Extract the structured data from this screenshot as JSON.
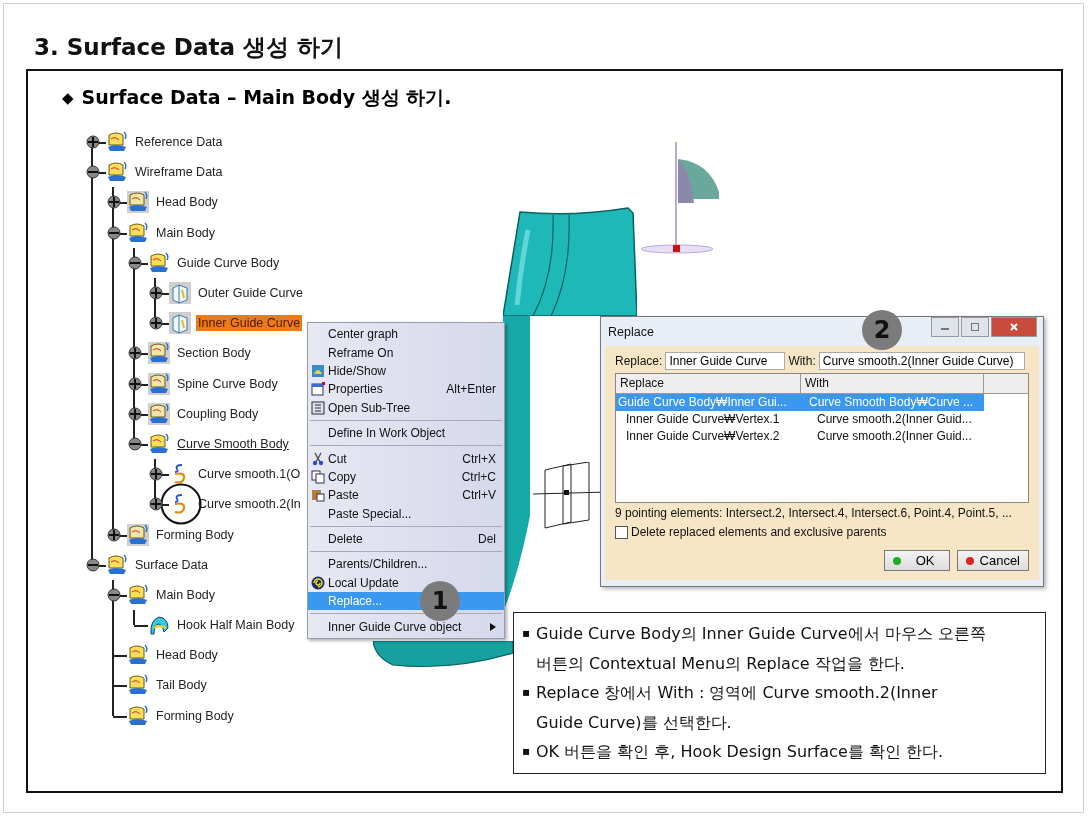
{
  "title": "3. Surface Data 생성 하기",
  "subtitle": {
    "bullet": "◆",
    "text": "Surface Data – Main Body 생성 하기."
  },
  "tree": {
    "items": [
      {
        "label": "Reference Data",
        "kind": "body",
        "expanded": false,
        "selected": false
      },
      {
        "label": "Wireframe Data",
        "kind": "body",
        "expanded": true,
        "selected": false,
        "children": [
          {
            "label": "Head Body",
            "kind": "greybody",
            "expanded": false,
            "selected": false
          },
          {
            "label": "Main Body",
            "kind": "body",
            "expanded": true,
            "selected": false,
            "children": [
              {
                "label": "Guide Curve Body",
                "kind": "body",
                "expanded": true,
                "selected": false,
                "children": [
                  {
                    "label": "Outer Guide Curve",
                    "kind": "sketch",
                    "expanded": false,
                    "selected": false
                  },
                  {
                    "label": "Inner Guide Curve",
                    "kind": "sketch",
                    "expanded": false,
                    "selected": true
                  }
                ]
              },
              {
                "label": "Section Body",
                "kind": "greybody",
                "expanded": false,
                "selected": false
              },
              {
                "label": "Spine Curve Body",
                "kind": "greybody",
                "expanded": false,
                "selected": false
              },
              {
                "label": "Coupling Body",
                "kind": "greybody",
                "expanded": false,
                "selected": false
              },
              {
                "label": "Curve Smooth Body",
                "kind": "body",
                "expanded": true,
                "selected": false,
                "underlined": true,
                "children": [
                  {
                    "label": "Curve smooth.1(O",
                    "kind": "curve",
                    "expanded": false,
                    "selected": false
                  },
                  {
                    "label": "Curve smooth.2(In",
                    "kind": "curve",
                    "expanded": false,
                    "selected": false,
                    "circled": true
                  }
                ]
              }
            ]
          },
          {
            "label": "Forming Body",
            "kind": "greybody",
            "expanded": false,
            "selected": false
          }
        ]
      },
      {
        "label": "Surface Data",
        "kind": "body",
        "expanded": true,
        "selected": false,
        "children": [
          {
            "label": "Main Body",
            "kind": "body",
            "expanded": true,
            "selected": false,
            "children": [
              {
                "label": "Hook Half Main Body",
                "kind": "surface",
                "selected": false
              }
            ]
          },
          {
            "label": "Head Body",
            "kind": "body",
            "selected": false
          },
          {
            "label": "Tail Body",
            "kind": "body",
            "selected": false
          },
          {
            "label": "Forming Body",
            "kind": "body",
            "selected": false
          }
        ]
      }
    ]
  },
  "menu": {
    "items": [
      {
        "kind": "item",
        "label": "Center graph",
        "selected": false
      },
      {
        "kind": "item",
        "label": "Reframe On",
        "selected": false
      },
      {
        "kind": "item",
        "label": "Hide/Show",
        "selected": false
      },
      {
        "kind": "item",
        "label": "Properties",
        "shortcut": "Alt+Enter",
        "selected": false
      },
      {
        "kind": "item",
        "label": "Open Sub-Tree",
        "selected": false
      },
      {
        "kind": "separator"
      },
      {
        "kind": "item",
        "label": "Define In Work Object",
        "selected": false
      },
      {
        "kind": "separator"
      },
      {
        "kind": "item",
        "label": "Cut",
        "shortcut": "Ctrl+X",
        "selected": false
      },
      {
        "kind": "item",
        "label": "Copy",
        "shortcut": "Ctrl+C",
        "selected": false
      },
      {
        "kind": "item",
        "label": "Paste",
        "shortcut": "Ctrl+V",
        "selected": false
      },
      {
        "kind": "item",
        "label": "Paste Special...",
        "selected": false
      },
      {
        "kind": "separator"
      },
      {
        "kind": "item",
        "label": "Delete",
        "shortcut": "Del",
        "selected": false
      },
      {
        "kind": "separator"
      },
      {
        "kind": "item",
        "label": "Parents/Children...",
        "selected": false
      },
      {
        "kind": "item",
        "label": "Local Update",
        "selected": false
      },
      {
        "kind": "item",
        "label": "Replace...",
        "selected": true
      },
      {
        "kind": "separator"
      },
      {
        "kind": "item",
        "label": "Inner Guide Curve object",
        "submenu": true,
        "selected": false
      }
    ]
  },
  "dialog": {
    "title": "Replace",
    "replace_label": "Replace:",
    "replace_value": "Inner Guide Curve",
    "with_label": "With:",
    "with_value": "Curve smooth.2(Inner Guide Curve)",
    "columns": [
      "Replace",
      "With"
    ],
    "rows": [
      {
        "replace": "Guide Curve Body₩Inner Gui...",
        "with": "Curve Smooth Body₩Curve ...",
        "selected": true
      },
      {
        "replace": "Inner Guide Curve₩Vertex.1",
        "with": "Curve smooth.2(Inner Guid...",
        "selected": false
      },
      {
        "replace": "Inner Guide Curve₩Vertex.2",
        "with": "Curve smooth.2(Inner Guid...",
        "selected": false
      }
    ],
    "status": "9 pointing elements: Intersect.2, Intersect.4, Intersect.6, Point.4, Point.5, ...",
    "checkbox": {
      "label": "Delete replaced elements and exclusive parents",
      "checked": false
    },
    "buttons": [
      {
        "label": "OK",
        "color": "#22aa22"
      },
      {
        "label": "Cancel",
        "color": "#dd2222"
      }
    ]
  },
  "badges": [
    {
      "label": "1"
    },
    {
      "label": "2"
    }
  ],
  "notes": [
    {
      "bullet": "▪",
      "text": "Guide Curve Body의 Inner Guide Curve에서 마우스 오른쪽 버튼의 Contextual Menu의 Replace 작업을 한다."
    },
    {
      "bullet": "▪",
      "text": "Replace 창에서 With : 영역에 Curve smooth.2(Inner Guide Curve)를 선택한다."
    },
    {
      "bullet": "▪",
      "text": "OK 버튼을 확인 후, Hook Design Surface를 확인 한다."
    }
  ]
}
